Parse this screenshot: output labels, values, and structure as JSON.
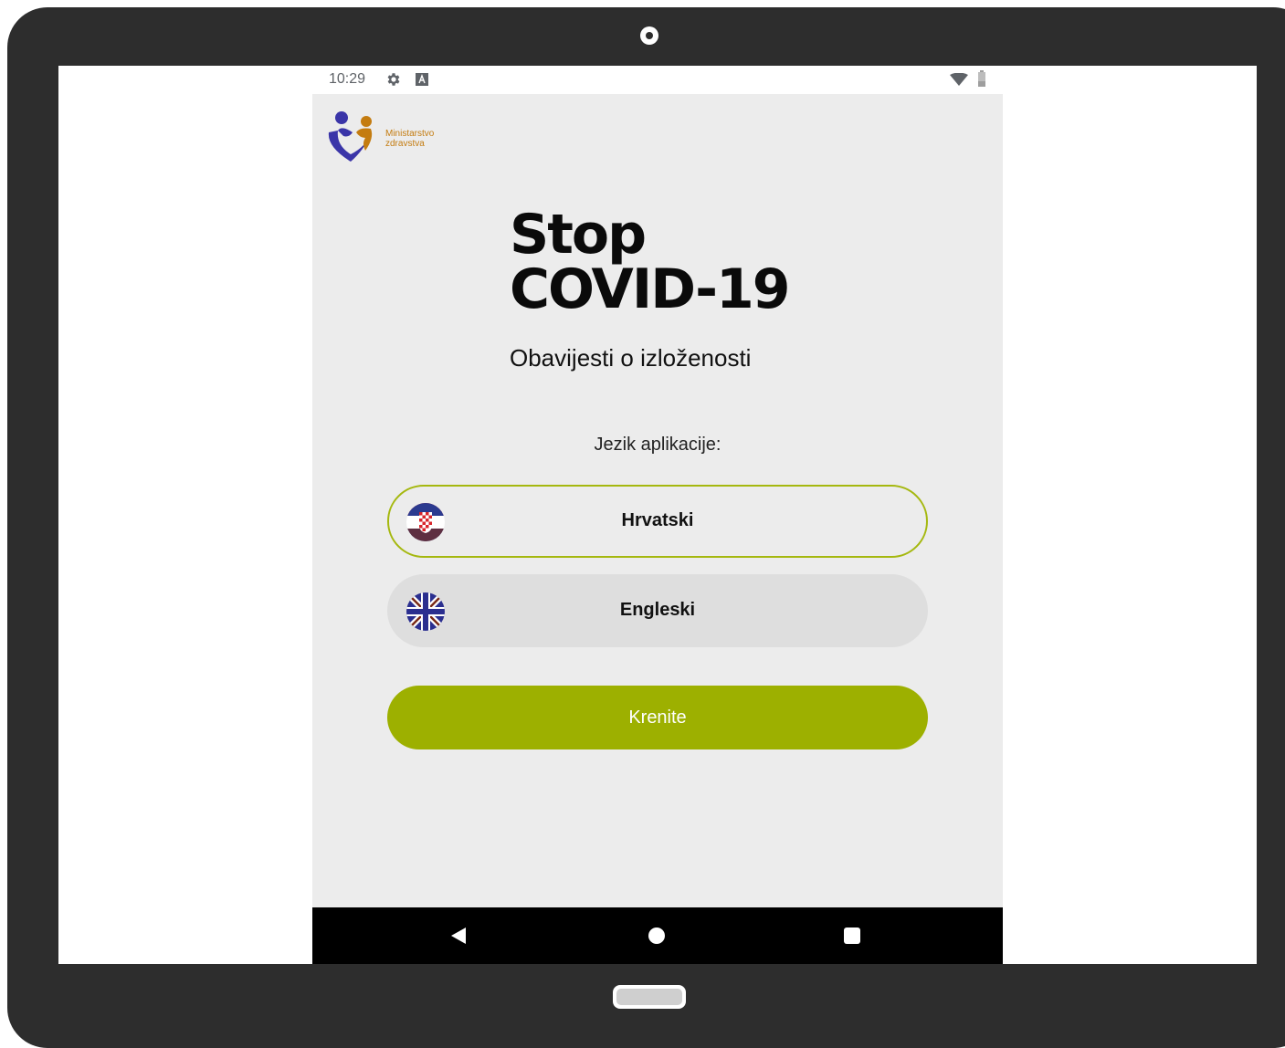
{
  "status_bar": {
    "time": "10:29",
    "icons": [
      "settings-gear-icon",
      "accessibility-a-icon",
      "wifi-icon",
      "battery-icon"
    ]
  },
  "logo": {
    "line1": "Ministarstvo",
    "line2": "zdravstva",
    "colors": {
      "blue": "#3a35a8",
      "orange": "#c47c10"
    }
  },
  "title": {
    "line1": "Stop",
    "line2": "COVID-19"
  },
  "subtitle": "Obavijesti o izloženosti",
  "language": {
    "label": "Jezik aplikacije:",
    "options": [
      {
        "label": "Hrvatski",
        "flag": "croatia-flag-icon",
        "selected": true
      },
      {
        "label": "Engleski",
        "flag": "uk-flag-icon",
        "selected": false
      }
    ]
  },
  "cta": {
    "label": "Krenite"
  },
  "nav": [
    "back-icon",
    "home-icon",
    "recents-icon"
  ],
  "colors": {
    "accent": "#9db000",
    "selected_border": "#a5b80f",
    "background": "#ececec",
    "bezel": "#2d2d2d"
  }
}
